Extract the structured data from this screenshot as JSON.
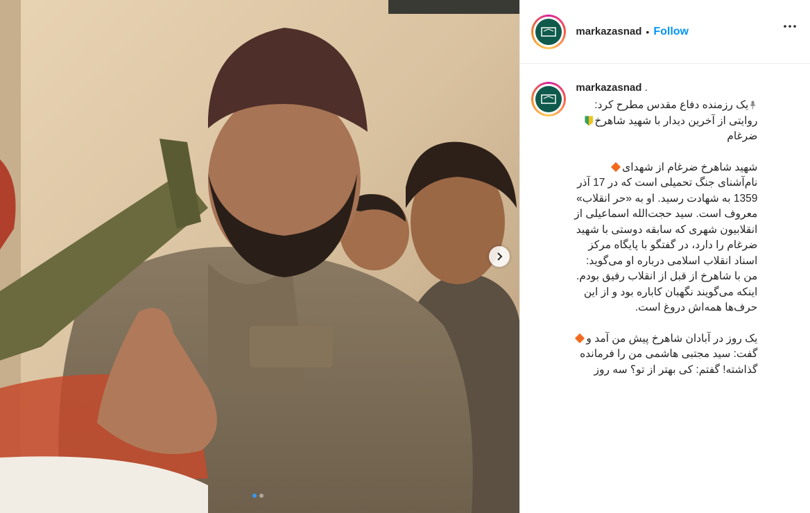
{
  "post": {
    "username": "markazasnad",
    "separator": "•",
    "follow_label": "Follow",
    "more_icon": "more-options-icon",
    "carousel": {
      "slide_count": 2,
      "active_index": 0
    }
  },
  "caption": {
    "username": "markazasnad",
    "username_suffix": ".",
    "lines": [
      "یک رزمنده دفاع مقدس مطرح کرد:",
      "روایتی از آخرین دیدار با شهید شاهرخ",
      "ضرغام",
      "",
      "شهید شاهرخ ضرغام از شهدای",
      "نام‌آشنای جنگ تحمیلی است که در 17 آذر",
      "1359 به شهادت رسید. او به «حر انقلاب»",
      "معروف است. سید حجت‌الله اسماعیلی از",
      "انقلابیون شهری که سابقه دوستی با شهید",
      "ضرغام را دارد، در گفتگو با پایگاه مرکز",
      "اسناد انقلاب اسلامی درباره او می‌گوید:",
      "من با شاهرخ از قبل از انقلاب رفیق بودم.",
      "اینکه می‌گویند نگهبان کاباره بود و از این",
      "حرف‌ها همه‌اش دروغ است.",
      "",
      "یک روز در آبادان شاهرخ پیش من آمد و",
      "گفت: سید مجتبی هاشمی من را فرمانده",
      "گذاشته! گفتم: کی بهتر از تو؟ سه روز"
    ]
  },
  "colors": {
    "follow": "#0095f6",
    "avatar_bg": "#0f5a4c",
    "diamond": "#f26b1d"
  }
}
